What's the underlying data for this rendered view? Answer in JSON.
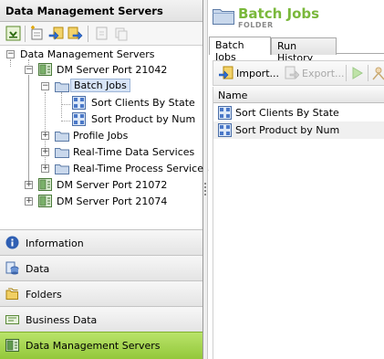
{
  "left_panel": {
    "title": "Data Management Servers",
    "tree": {
      "root": "Data Management Servers",
      "server_1": "DM Server Port 21042",
      "batch_jobs": "Batch Jobs",
      "job_1": "Sort Clients By State",
      "job_2": "Sort Product by Num",
      "profile_jobs": "Profile Jobs",
      "realtime_data": "Real-Time Data Services",
      "realtime_process": "Real-Time Process Services",
      "server_2": "DM Server Port 21072",
      "server_3": "DM Server Port 21074"
    },
    "accordion": [
      {
        "label": "Information"
      },
      {
        "label": "Data"
      },
      {
        "label": "Folders"
      },
      {
        "label": "Business Data"
      },
      {
        "label": "Data Management Servers"
      }
    ]
  },
  "right_panel": {
    "title": "Batch Jobs",
    "subtitle": "FOLDER",
    "tabs": [
      {
        "label": "Batch Jobs"
      },
      {
        "label": "Run History"
      }
    ],
    "toolbar": {
      "import_label": "Import...",
      "export_label": "Export..."
    },
    "grid": {
      "column_name": "Name",
      "rows": [
        {
          "name": "Sort Clients By State"
        },
        {
          "name": "Sort Product by Num"
        }
      ]
    }
  },
  "colors": {
    "accent_green": "#7ab83b",
    "active_accordion": "#93c83a",
    "selection": "#d7e4f7"
  },
  "icons": [
    "expand-icon",
    "new-folder-icon",
    "import-icon",
    "export-icon",
    "refresh-icon",
    "copy-icon",
    "server-icon",
    "folder-icon",
    "job-icon",
    "info-icon",
    "data-icon",
    "folders-icon",
    "business-data-icon",
    "run-icon"
  ]
}
